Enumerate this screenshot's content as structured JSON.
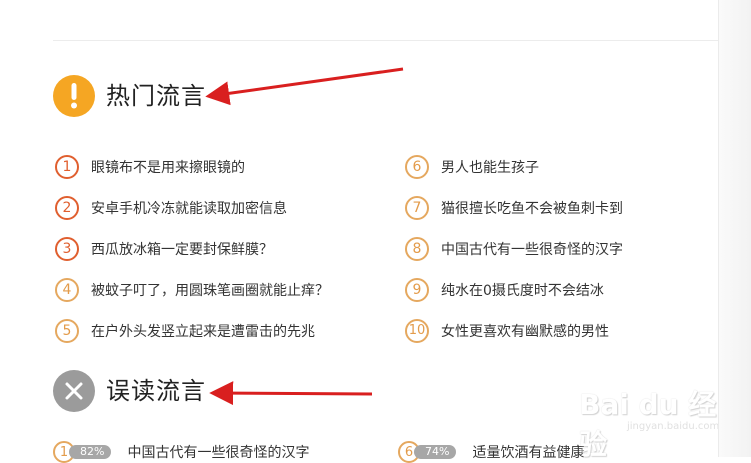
{
  "sections": {
    "hot": {
      "title": "热门流言",
      "icon": "exclamation-icon",
      "icon_symbol": "!",
      "color": "#f5a623"
    },
    "wrong": {
      "title": "误读流言",
      "icon": "close-icon",
      "icon_symbol": "✕",
      "color": "#9b9b9b"
    }
  },
  "hot_list": {
    "left": [
      {
        "rank": "1",
        "text": "眼镜布不是用来擦眼镜的"
      },
      {
        "rank": "2",
        "text": "安卓手机冷冻就能读取加密信息"
      },
      {
        "rank": "3",
        "text": "西瓜放冰箱一定要封保鲜膜？"
      },
      {
        "rank": "4",
        "text": "被蚊子叮了，用圆珠笔画圈就能止痒？"
      },
      {
        "rank": "5",
        "text": "在户外头发竖立起来是遭雷击的先兆"
      }
    ],
    "right": [
      {
        "rank": "6",
        "text": "男人也能生孩子"
      },
      {
        "rank": "7",
        "text": "猫很擅长吃鱼不会被鱼刺卡到"
      },
      {
        "rank": "8",
        "text": "中国古代有一些很奇怪的汉字"
      },
      {
        "rank": "9",
        "text": "纯水在0摄氏度时不会结冰"
      },
      {
        "rank": "10",
        "text": "女性更喜欢有幽默感的男性"
      }
    ]
  },
  "wrong_list": {
    "left": {
      "rank": "1",
      "percent": "82%",
      "text": "中国古代有一些很奇怪的汉字"
    },
    "right": {
      "rank": "6",
      "percent": "74%",
      "text": "适量饮酒有益健康"
    }
  },
  "watermark": {
    "brand": "Bai du 经验",
    "url": "jingyan.baidu.com"
  },
  "colors": {
    "accent_orange": "#f5a623",
    "rank_red": "#e05f2f",
    "rank_orange": "#e5a85f",
    "arrow_red": "#d91f1f"
  }
}
